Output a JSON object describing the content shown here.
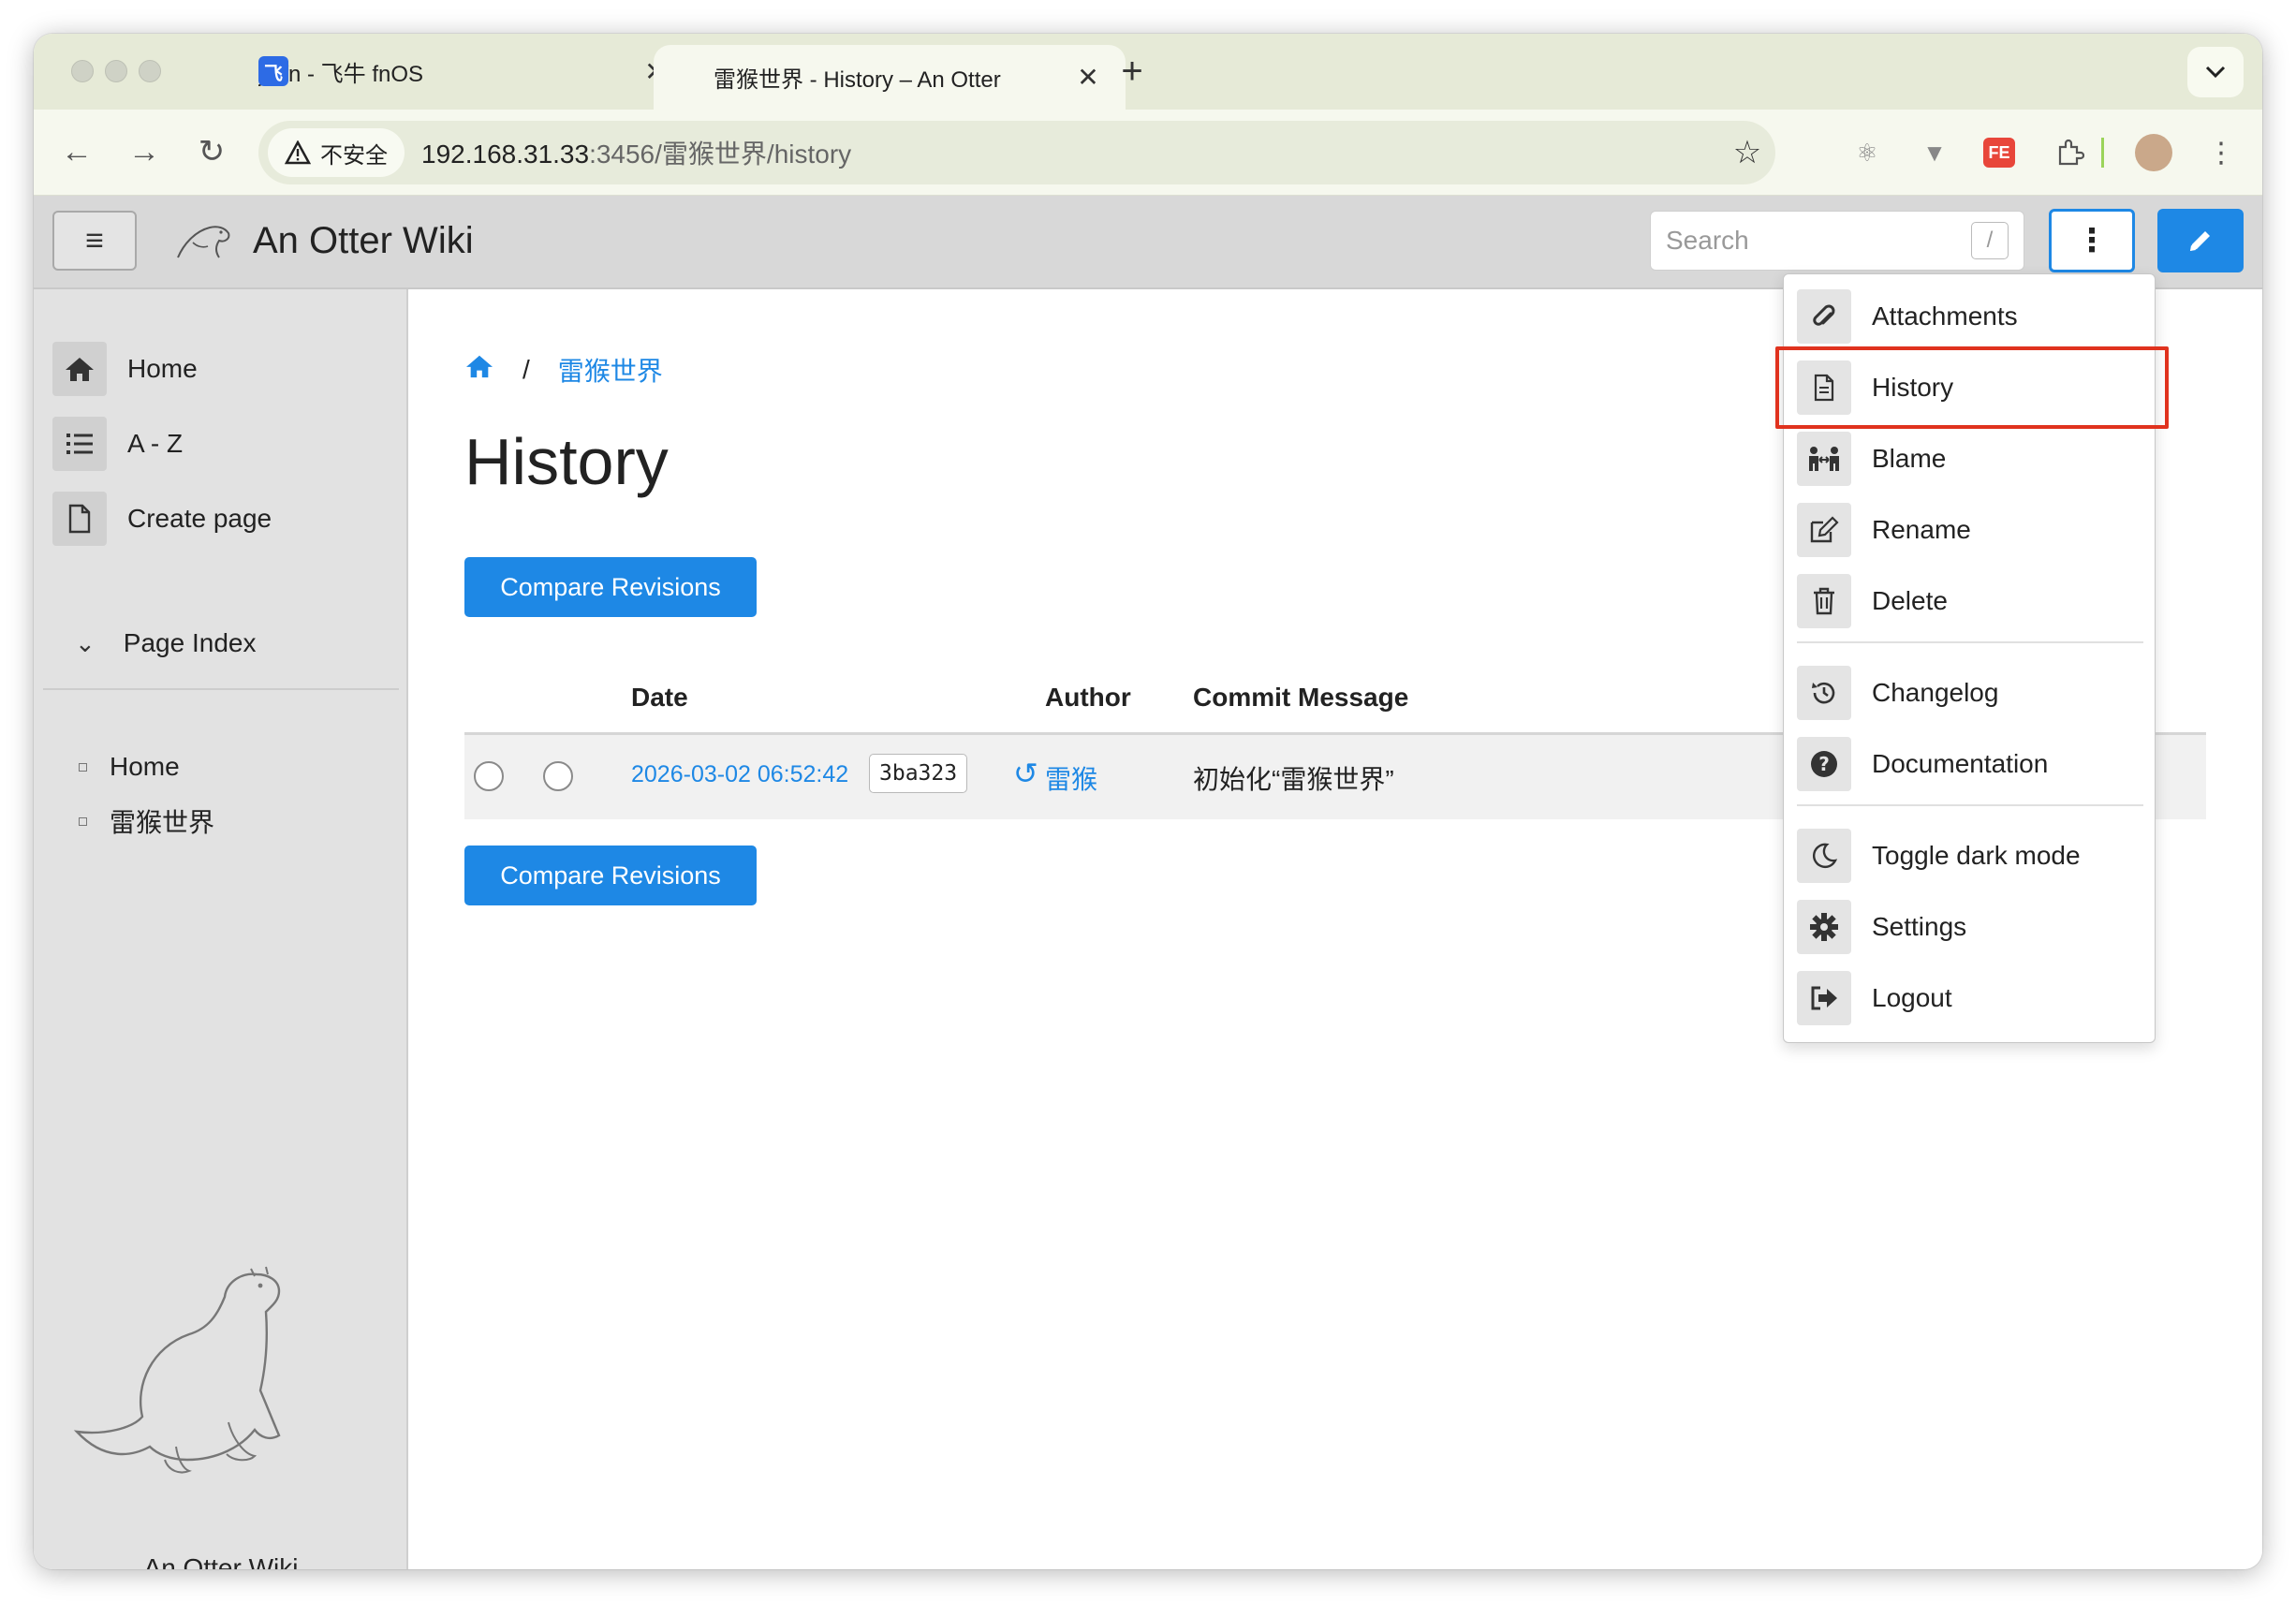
{
  "browser": {
    "tabs": [
      {
        "title": "jk-fn - 飞牛 fnOS",
        "favicon": "飞"
      },
      {
        "title": "雷猴世界 - History – An Otter"
      }
    ],
    "new_tab_label": "+",
    "close_label": "✕",
    "security_label": "不安全",
    "url_host": "192.168.31.33",
    "url_rest": ":3456/雷猴世界/history",
    "ext_fe_label": "FE"
  },
  "wiki": {
    "title": "An Otter Wiki",
    "search_placeholder": "Search",
    "search_hotkey": "/"
  },
  "sidebar": {
    "items": [
      {
        "label": "Home",
        "icon": "home-icon"
      },
      {
        "label": "A - Z",
        "icon": "list-icon"
      },
      {
        "label": "Create page",
        "icon": "file-icon"
      }
    ],
    "page_index_label": "Page Index",
    "page_index": [
      "Home",
      "雷猴世界"
    ],
    "footer": "An Otter Wiki"
  },
  "main": {
    "breadcrumb_sep": "/",
    "breadcrumb_page": "雷猴世界",
    "page_title": "History",
    "compare_label": "Compare Revisions",
    "columns": [
      "Date",
      "Author",
      "Commit Message"
    ],
    "rows": [
      {
        "date": "2026-03-02 06:52:42",
        "sha": "3ba323",
        "author": "雷猴",
        "message": "初始化“雷猴世界”"
      }
    ]
  },
  "menu": {
    "items": [
      {
        "label": "Attachments",
        "icon": "paperclip-icon"
      },
      {
        "label": "History",
        "icon": "file-text-icon"
      },
      {
        "label": "Blame",
        "icon": "people-arrows-icon"
      },
      {
        "label": "Rename",
        "icon": "edit-icon"
      },
      {
        "label": "Delete",
        "icon": "trash-icon"
      },
      {
        "label": "Changelog",
        "icon": "history-icon"
      },
      {
        "label": "Documentation",
        "icon": "question-circle-icon"
      },
      {
        "label": "Toggle dark mode",
        "icon": "moon-icon"
      },
      {
        "label": "Settings",
        "icon": "gear-icon"
      },
      {
        "label": "Logout",
        "icon": "sign-out-icon"
      }
    ],
    "highlighted": "History"
  },
  "colors": {
    "accent": "#1e88e5",
    "highlight_box": "#e0321e",
    "header_bg": "#d8d8d8",
    "sidebar_bg": "#e2e2e2"
  }
}
